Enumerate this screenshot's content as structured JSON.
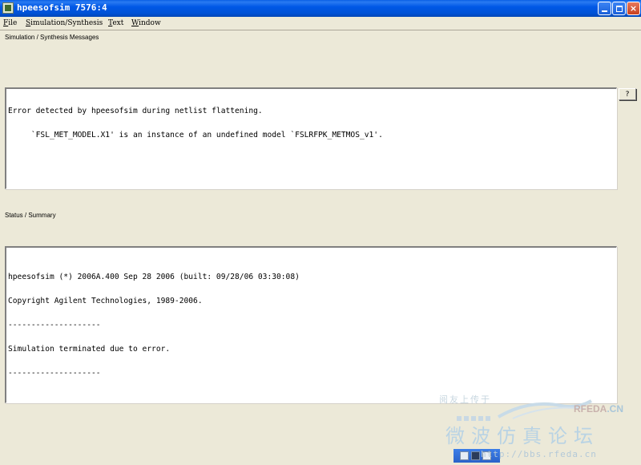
{
  "window": {
    "title": "hpeesofsim 7576:4",
    "controls": {
      "minimize": "minimize",
      "maximize": "maximize",
      "close": "×"
    }
  },
  "menu": [
    "File",
    "Simulation/Synthesis",
    "Text",
    "Window"
  ],
  "messages": {
    "label": "Simulation / Synthesis Messages",
    "lines": [
      "Error detected by hpeesofsim during netlist flattening.",
      "     `FSL_MET_MODEL.X1' is an instance of an undefined model `FSLRFPK_METMOS_v1'."
    ]
  },
  "help_button": "?",
  "summary": {
    "label": "Status / Summary",
    "lines": [
      "hpeesofsim (*) 2006A.400 Sep 28 2006 (built: 09/28/06 03:30:08)",
      "Copyright Agilent Technologies, 1989-2006.",
      "--------------------",
      "Simulation terminated due to error.",
      "--------------------"
    ]
  },
  "watermark": {
    "small": "阅友上传于",
    "brand_main": "RFEDA",
    "brand_suffix": ".CN",
    "big": "微波仿真论坛",
    "url": "http://bbs.rfeda.cn"
  },
  "icons": [
    "app-icon",
    "minimize-icon",
    "maximize-icon",
    "close-icon",
    "help-icon"
  ]
}
